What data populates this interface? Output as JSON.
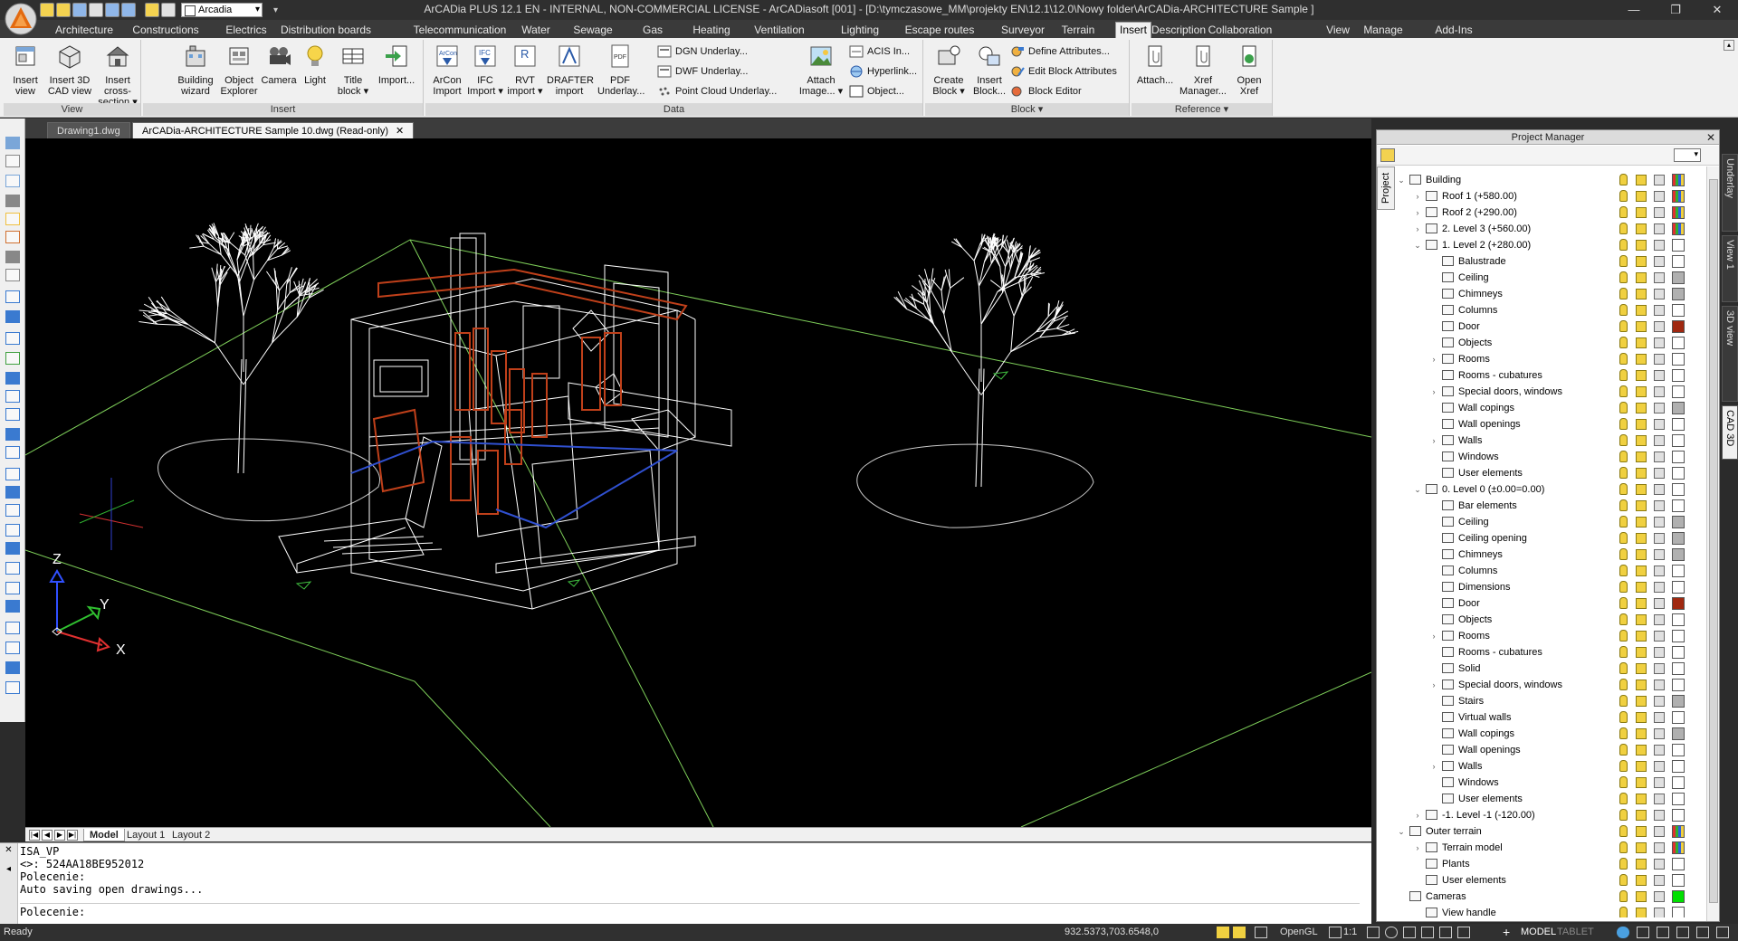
{
  "app": {
    "title": "ArCADia PLUS 12.1 EN - INTERNAL, NON-COMMERCIAL LICENSE - ArCADiasoft [001] - [D:\\tymczasowe_MM\\projekty EN\\12.1\\12.0\\Nowy folder\\ArCADia-ARCHITECTURE Sample ]",
    "workspace": "Arcadia"
  },
  "ribbon_tabs": [
    "Architecture",
    "Constructions",
    "Electrics",
    "Distribution boards",
    "Telecommunication",
    "Water",
    "Sewage",
    "Gas",
    "Heating",
    "Ventilation",
    "Lighting",
    "Escape routes",
    "Surveyor",
    "Terrain",
    "Insert",
    "Description",
    "Collaboration",
    "View",
    "Manage",
    "Add-Ins"
  ],
  "active_tab": "Insert",
  "panels": {
    "view": {
      "title": "View",
      "buttons": [
        {
          "l1": "Insert",
          "l2": "view",
          "icon": "insert-view-icon"
        },
        {
          "l1": "Insert 3D",
          "l2": "CAD view",
          "icon": "insert-3d-cad-view-icon"
        },
        {
          "l1": "Insert",
          "l2": "cross-section ▾",
          "icon": "insert-cross-section-icon"
        }
      ]
    },
    "insert": {
      "title": "Insert",
      "buttons": [
        {
          "l1": "Building",
          "l2": "wizard",
          "icon": "building-wizard-icon"
        },
        {
          "l1": "Object",
          "l2": "Explorer",
          "icon": "object-explorer-icon"
        },
        {
          "l1": "Camera",
          "l2": "",
          "icon": "camera-icon"
        },
        {
          "l1": "Light",
          "l2": "",
          "icon": "light-icon"
        },
        {
          "l1": "Title",
          "l2": "block ▾",
          "icon": "title-block-icon"
        },
        {
          "l1": "Import...",
          "l2": "",
          "icon": "import-icon"
        }
      ]
    },
    "data": {
      "title": "Data",
      "buttons": [
        {
          "l1": "ArCon",
          "l2": "Import",
          "icon": "arcon-import-icon"
        },
        {
          "l1": "IFC",
          "l2": "Import ▾",
          "icon": "ifc-import-icon"
        },
        {
          "l1": "RVT",
          "l2": "import ▾",
          "icon": "rvt-import-icon"
        },
        {
          "l1": "DRAFTER",
          "l2": "import",
          "icon": "drafter-import-icon"
        },
        {
          "l1": "PDF",
          "l2": "Underlay...",
          "icon": "pdf-underlay-icon"
        }
      ],
      "small": [
        "DGN Underlay...",
        "DWF Underlay...",
        "Point Cloud Underlay..."
      ],
      "attach": {
        "l1": "Attach",
        "l2": "Image... ▾"
      },
      "small2": [
        "ACIS In...",
        "Hyperlink...",
        "Object..."
      ]
    },
    "block": {
      "title": "Block ▾",
      "buttons": [
        {
          "l1": "Create",
          "l2": "Block ▾",
          "icon": "create-block-icon"
        },
        {
          "l1": "Insert",
          "l2": "Block...",
          "icon": "insert-block-icon"
        }
      ],
      "small": [
        "Define Attributes...",
        "Edit Block Attributes",
        "Block Editor"
      ]
    },
    "reference": {
      "title": "Reference ▾",
      "buttons": [
        {
          "l1": "Attach...",
          "l2": "",
          "icon": "attach-icon"
        },
        {
          "l1": "Xref",
          "l2": "Manager...",
          "icon": "xref-manager-icon"
        },
        {
          "l1": "Open",
          "l2": "Xref",
          "icon": "open-xref-icon"
        }
      ]
    }
  },
  "document_tabs": [
    {
      "label": "Drawing1.dwg",
      "active": false
    },
    {
      "label": "ArCADia-ARCHITECTURE Sample 10.dwg (Read-only)",
      "active": true
    }
  ],
  "layout_tabs": [
    "Model",
    "Layout 1",
    "Layout 2"
  ],
  "axes": {
    "z": "Z",
    "y": "Y",
    "x": "X"
  },
  "command_history": [
    "ISA_VP",
    "<>: 524AA18BE952012",
    "Polecenie:",
    "Auto saving open drawings..."
  ],
  "command_prompt": "Polecenie:",
  "status": {
    "left": "Ready",
    "coords": "932.5373,703.6548,0",
    "renderer": "OpenGL",
    "scale": "1:1",
    "model": "MODEL",
    "tablet": "TABLET"
  },
  "project_manager": {
    "title": "Project Manager",
    "side_tab": "Project",
    "tree": [
      {
        "label": "Building",
        "level": 0,
        "exp": "⌄",
        "color": "#ffffff",
        "multi": true
      },
      {
        "label": "Roof 1 (+580.00)",
        "level": 1,
        "exp": "›",
        "color": "#ffffff",
        "multi": true
      },
      {
        "label": "Roof 2 (+290.00)",
        "level": 1,
        "exp": "›",
        "color": "#ffffff",
        "multi": true
      },
      {
        "label": "2. Level 3 (+560.00)",
        "level": 1,
        "exp": "›",
        "color": "#ffffff",
        "multi": true
      },
      {
        "label": "1. Level 2 (+280.00)",
        "level": 1,
        "exp": "⌄",
        "color": "#ffffff",
        "multi": false
      },
      {
        "label": "Balustrade",
        "level": 2,
        "exp": "",
        "color": "#ffffff"
      },
      {
        "label": "Ceiling",
        "level": 2,
        "exp": "",
        "color": "#b0b0b0"
      },
      {
        "label": "Chimneys",
        "level": 2,
        "exp": "",
        "color": "#b0b0b0"
      },
      {
        "label": "Columns",
        "level": 2,
        "exp": "",
        "color": "#ffffff"
      },
      {
        "label": "Door",
        "level": 2,
        "exp": "",
        "color": "#a02810"
      },
      {
        "label": "Objects",
        "level": 2,
        "exp": "",
        "color": "#ffffff"
      },
      {
        "label": "Rooms",
        "level": 2,
        "exp": "›",
        "color": "#ffffff"
      },
      {
        "label": "Rooms - cubatures",
        "level": 2,
        "exp": "",
        "color": "#ffffff"
      },
      {
        "label": "Special doors, windows",
        "level": 2,
        "exp": "›",
        "color": "#ffffff"
      },
      {
        "label": "Wall copings",
        "level": 2,
        "exp": "",
        "color": "#b0b0b0"
      },
      {
        "label": "Wall openings",
        "level": 2,
        "exp": "",
        "color": "#ffffff"
      },
      {
        "label": "Walls",
        "level": 2,
        "exp": "›",
        "color": "#ffffff"
      },
      {
        "label": "Windows",
        "level": 2,
        "exp": "",
        "color": "#ffffff"
      },
      {
        "label": "User elements",
        "level": 2,
        "exp": "",
        "color": "#ffffff"
      },
      {
        "label": "0. Level 0 (±0.00=0.00)",
        "level": 1,
        "exp": "⌄",
        "color": "#ffffff"
      },
      {
        "label": "Bar elements",
        "level": 2,
        "exp": "",
        "color": "#ffffff"
      },
      {
        "label": "Ceiling",
        "level": 2,
        "exp": "",
        "color": "#b0b0b0"
      },
      {
        "label": "Ceiling opening",
        "level": 2,
        "exp": "",
        "color": "#b0b0b0"
      },
      {
        "label": "Chimneys",
        "level": 2,
        "exp": "",
        "color": "#b0b0b0"
      },
      {
        "label": "Columns",
        "level": 2,
        "exp": "",
        "color": "#ffffff"
      },
      {
        "label": "Dimensions",
        "level": 2,
        "exp": "",
        "color": "#ffffff"
      },
      {
        "label": "Door",
        "level": 2,
        "exp": "",
        "color": "#a02810"
      },
      {
        "label": "Objects",
        "level": 2,
        "exp": "",
        "color": "#ffffff"
      },
      {
        "label": "Rooms",
        "level": 2,
        "exp": "›",
        "color": "#ffffff"
      },
      {
        "label": "Rooms - cubatures",
        "level": 2,
        "exp": "",
        "color": "#ffffff"
      },
      {
        "label": "Solid",
        "level": 2,
        "exp": "",
        "color": "#ffffff"
      },
      {
        "label": "Special doors, windows",
        "level": 2,
        "exp": "›",
        "color": "#ffffff"
      },
      {
        "label": "Stairs",
        "level": 2,
        "exp": "",
        "color": "#b0b0b0"
      },
      {
        "label": "Virtual walls",
        "level": 2,
        "exp": "",
        "color": "#ffffff"
      },
      {
        "label": "Wall copings",
        "level": 2,
        "exp": "",
        "color": "#b0b0b0"
      },
      {
        "label": "Wall openings",
        "level": 2,
        "exp": "",
        "color": "#ffffff"
      },
      {
        "label": "Walls",
        "level": 2,
        "exp": "›",
        "color": "#ffffff"
      },
      {
        "label": "Windows",
        "level": 2,
        "exp": "",
        "color": "#ffffff"
      },
      {
        "label": "User elements",
        "level": 2,
        "exp": "",
        "color": "#ffffff"
      },
      {
        "label": "-1. Level -1 (-120.00)",
        "level": 1,
        "exp": "›",
        "color": "#ffffff"
      },
      {
        "label": "Outer terrain",
        "level": 0,
        "exp": "⌄",
        "color": "#ffffff",
        "multi": true
      },
      {
        "label": "Terrain model",
        "level": 1,
        "exp": "›",
        "color": "#ffffff",
        "multi": true
      },
      {
        "label": "Plants",
        "level": 1,
        "exp": "",
        "color": "#ffffff"
      },
      {
        "label": "User elements",
        "level": 1,
        "exp": "",
        "color": "#ffffff"
      },
      {
        "label": "Cameras",
        "level": 0,
        "exp": "",
        "color": "#00e000"
      },
      {
        "label": "View handle",
        "level": 1,
        "exp": "",
        "color": "#ffffff"
      }
    ]
  },
  "right_vtabs": [
    "Underlay",
    "View 1",
    "3D view",
    "CAD 3D"
  ]
}
